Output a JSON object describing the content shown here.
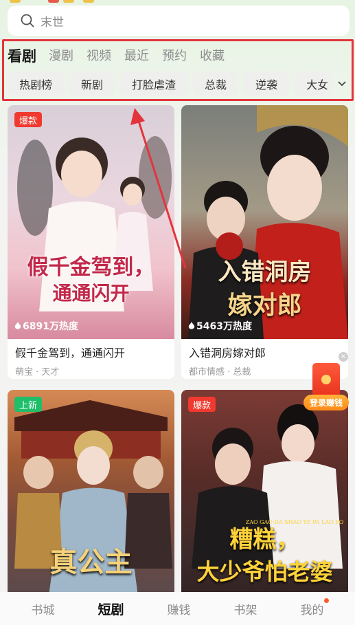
{
  "search": {
    "placeholder": "末世"
  },
  "tabs": [
    {
      "label": "看剧",
      "active": true
    },
    {
      "label": "漫剧"
    },
    {
      "label": "视频"
    },
    {
      "label": "最近"
    },
    {
      "label": "预约"
    },
    {
      "label": "收藏"
    }
  ],
  "chips": [
    "热剧榜",
    "新剧",
    "打脸虐渣",
    "总裁",
    "逆袭",
    "大女"
  ],
  "cards": [
    {
      "badge": "爆款",
      "badge_color": "#f0392f",
      "heat": "6891万热度",
      "title": "假千金驾到，通通闪开",
      "tags": "萌宝 · 天才",
      "poster_text_1": "假千金驾到，",
      "poster_text_2": "通通闪开"
    },
    {
      "heat": "5463万热度",
      "title": "入错洞房嫁对郎",
      "tags": "都市情感 · 总裁",
      "poster_text_1": "入错洞房",
      "poster_text_2": "嫁对郎"
    },
    {
      "badge": "上新",
      "badge_color": "#1fbf6a",
      "poster_text_1": "真公主"
    },
    {
      "badge": "爆款",
      "badge_color": "#f0392f",
      "poster_text_1": "糟糕，",
      "poster_text_2": "大少爷怕老婆",
      "poster_small": "ZAO GAO DA SHAO YE PA LAO PO"
    }
  ],
  "float_widget": {
    "label": "登录赚钱"
  },
  "bottom_nav": [
    {
      "label": "书城"
    },
    {
      "label": "短剧",
      "active": true
    },
    {
      "label": "赚钱"
    },
    {
      "label": "书架"
    },
    {
      "label": "我的",
      "dot": true
    }
  ],
  "colors": {
    "highlight_border": "#e3343c",
    "accent_orange": "#ff8a18"
  }
}
